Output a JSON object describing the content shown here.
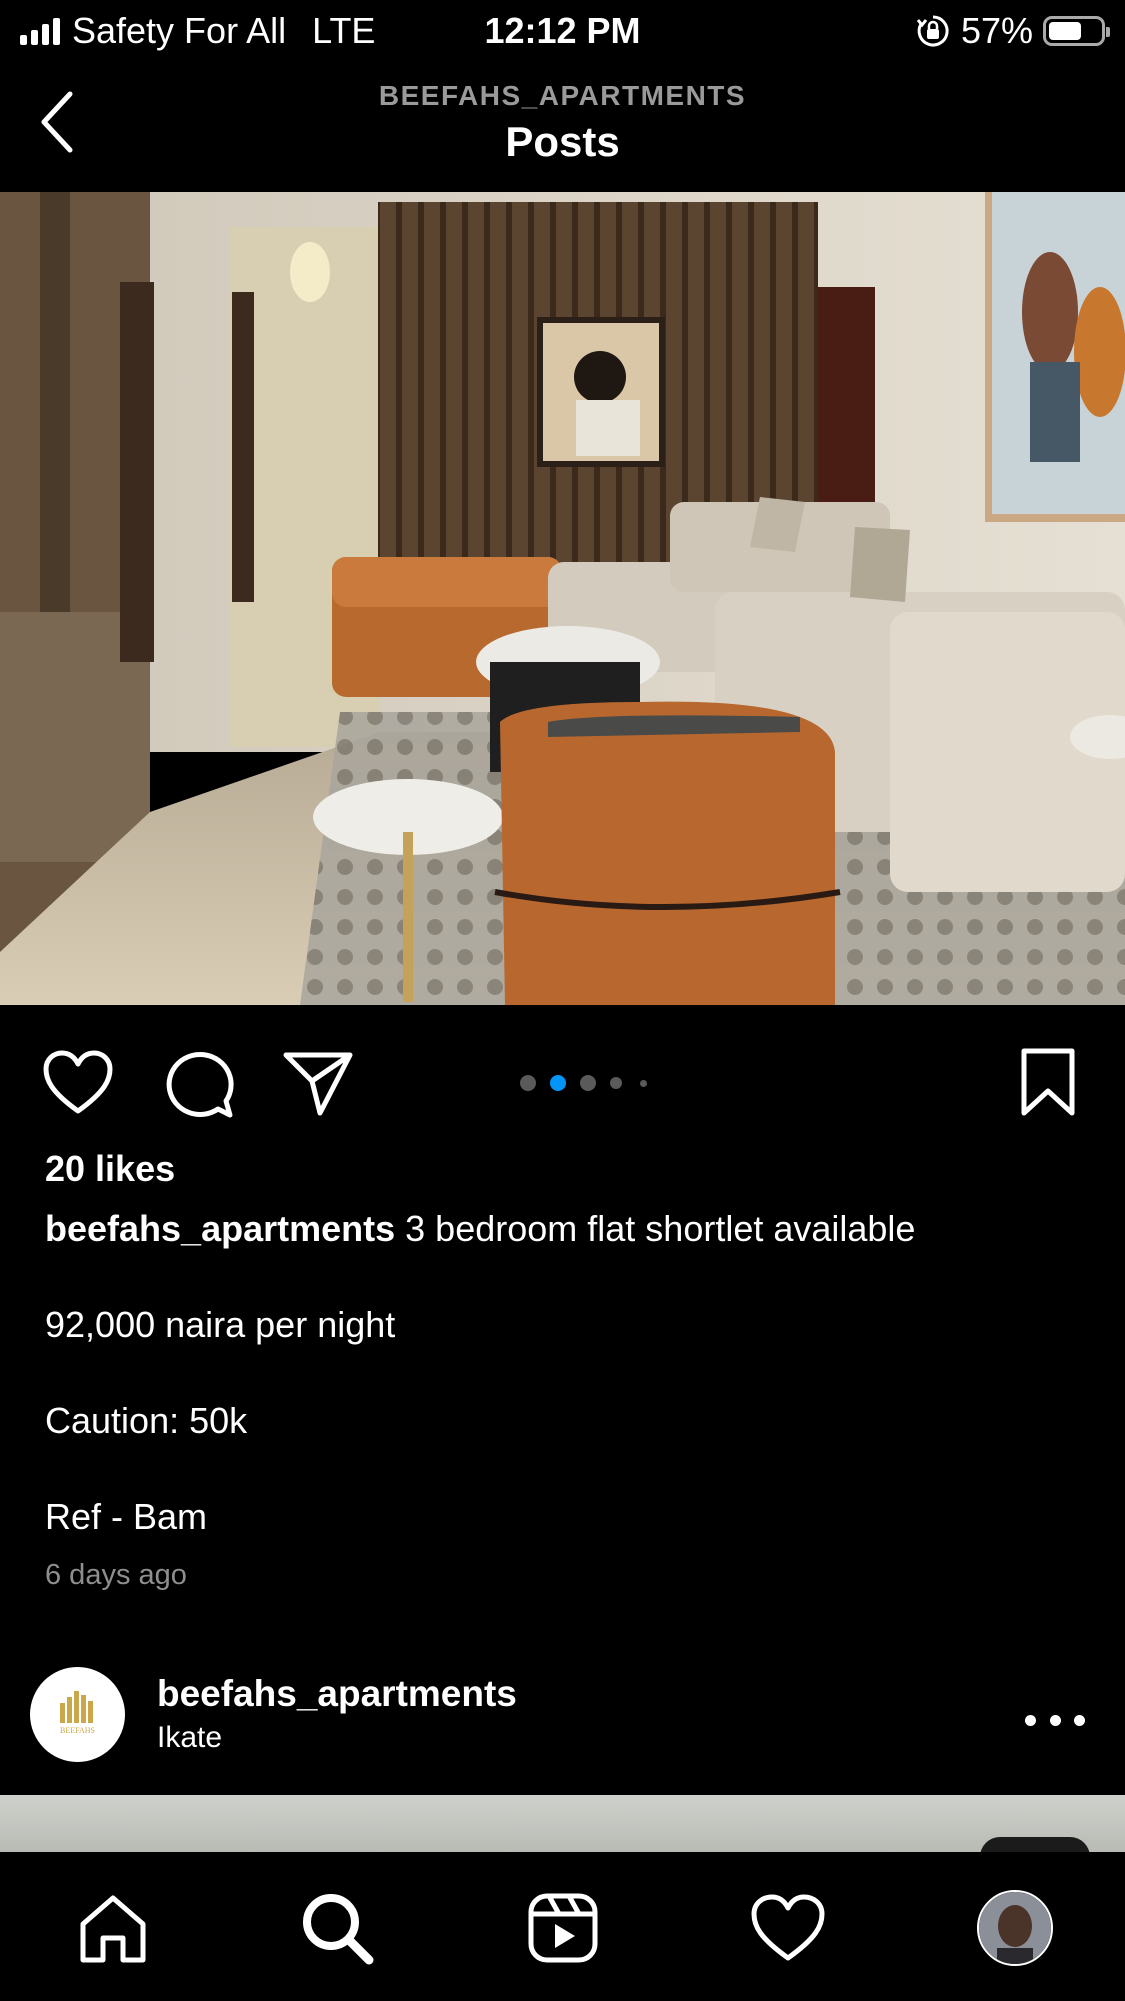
{
  "status_bar": {
    "carrier": "Safety For All",
    "network": "LTE",
    "time": "12:12 PM",
    "battery": "57%",
    "battery_level": 0.57,
    "icons": [
      "signal-icon",
      "orientation-lock-icon",
      "battery-icon"
    ]
  },
  "header": {
    "subtitle": "BEEFAHS_APARTMENTS",
    "title": "Posts",
    "back_icon": "chevron-left-icon"
  },
  "post": {
    "carousel": {
      "count": 5,
      "active_index": 1
    },
    "actions": [
      "heart-icon",
      "comment-icon",
      "share-icon",
      "bookmark-icon"
    ],
    "likes": "20 likes",
    "caption": {
      "username": "beefahs_apartments",
      "text": "3 bedroom flat shortlet available",
      "price": "92,000 naira per night",
      "caution": "Caution: 50k",
      "ref": "Ref - Bam"
    },
    "time_ago": "6 days ago"
  },
  "next_post": {
    "username": "beefahs_apartments",
    "location": "Ikate",
    "logo_text": "BEEFAHS"
  },
  "tab_bar": {
    "items": [
      "home-icon",
      "search-icon",
      "reels-icon",
      "activity-heart-icon",
      "profile-avatar"
    ]
  },
  "colors": {
    "background": "#000000",
    "active_dot": "#0095f6",
    "muted_text": "#8e8e8e",
    "logo_gold": "#c9a74a"
  }
}
